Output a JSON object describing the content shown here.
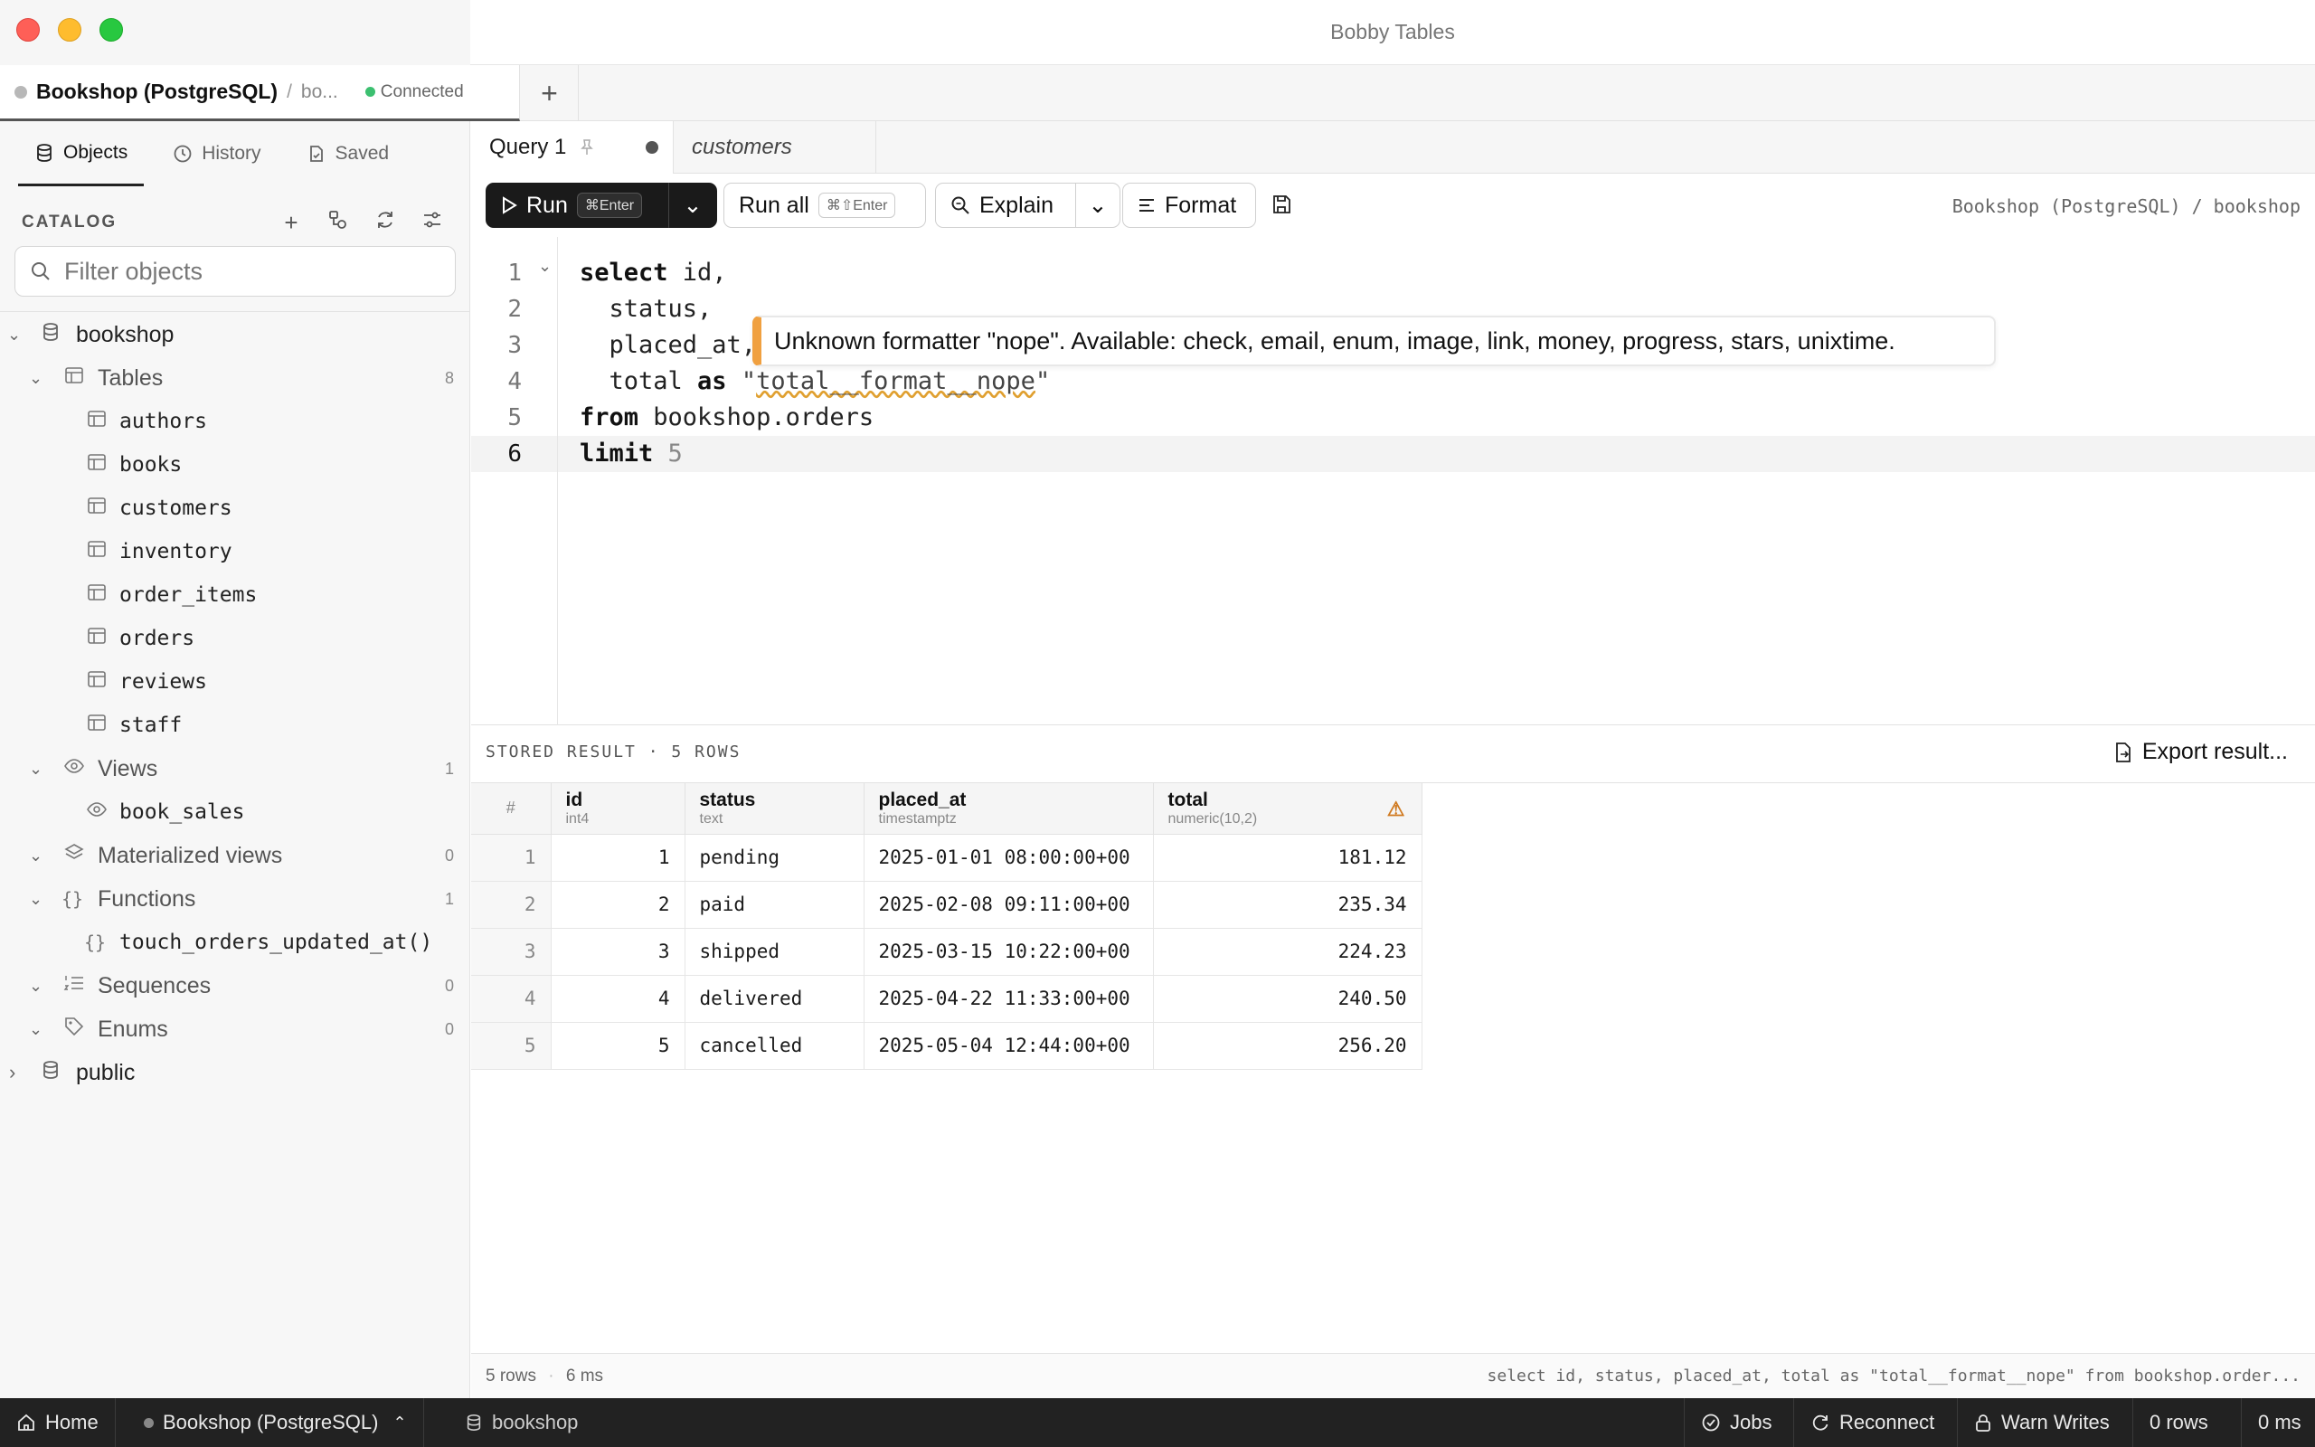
{
  "window": {
    "title": "Bobby Tables"
  },
  "connection_tab": {
    "name": "Bookshop (PostgreSQL)",
    "separator": "/",
    "database": "bo...",
    "status": "Connected",
    "status_color": "#3cc070"
  },
  "sidebar": {
    "tabs": [
      {
        "label": "Objects"
      },
      {
        "label": "History"
      },
      {
        "label": "Saved"
      }
    ],
    "catalog_label": "CATALOG",
    "filter_placeholder": "Filter objects",
    "tree": {
      "schema": "bookshop",
      "tables_label": "Tables",
      "tables_count": "8",
      "tables": [
        "authors",
        "books",
        "customers",
        "inventory",
        "order_items",
        "orders",
        "reviews",
        "staff"
      ],
      "views_label": "Views",
      "views_count": "1",
      "views": [
        "book_sales"
      ],
      "matviews_label": "Materialized views",
      "matviews_count": "0",
      "functions_label": "Functions",
      "functions_count": "1",
      "functions": [
        "touch_orders_updated_at()"
      ],
      "sequences_label": "Sequences",
      "sequences_count": "0",
      "enums_label": "Enums",
      "enums_count": "0",
      "schema2": "public"
    }
  },
  "query_tabs": [
    {
      "label": "Query 1"
    },
    {
      "label": "customers"
    }
  ],
  "toolbar": {
    "run_label": "Run",
    "run_shortcut": "⌘Enter",
    "run_all_label": "Run all",
    "run_all_shortcut": "⌘⇧Enter",
    "explain_label": "Explain",
    "format_label": "Format",
    "breadcrumb": "Bookshop (PostgreSQL) / bookshop"
  },
  "editor": {
    "line_numbers": [
      "1",
      "2",
      "3",
      "4",
      "5",
      "6"
    ],
    "lines": {
      "l1_kw": "select",
      "l1_rest": " id,",
      "l2": "  status,",
      "l3": "  placed_at,",
      "l4_a": "  total ",
      "l4_kw": "as",
      "l4_q1": " \"",
      "l4_str": "total__format__nope",
      "l4_q2": "\"",
      "l5_kw": "from",
      "l5_rest": " bookshop.orders",
      "l6_kw": "limit",
      "l6_num": "5"
    },
    "tooltip": "Unknown formatter \"nope\". Available: check, email, enum, image, link, money, progress, stars, unixtime."
  },
  "results": {
    "title": "STORED RESULT · 5 ROWS",
    "export_label": "Export result...",
    "columns": [
      {
        "name": "id",
        "type": "int4"
      },
      {
        "name": "status",
        "type": "text"
      },
      {
        "name": "placed_at",
        "type": "timestamptz"
      },
      {
        "name": "total",
        "type": "numeric(10,2)"
      }
    ],
    "rownum_header": "#",
    "rows": [
      {
        "n": "1",
        "id": "1",
        "status": "pending",
        "placed_at": "2025-01-01 08:00:00+00",
        "total": "181.12"
      },
      {
        "n": "2",
        "id": "2",
        "status": "paid",
        "placed_at": "2025-02-08 09:11:00+00",
        "total": "235.34"
      },
      {
        "n": "3",
        "id": "3",
        "status": "shipped",
        "placed_at": "2025-03-15 10:22:00+00",
        "total": "224.23"
      },
      {
        "n": "4",
        "id": "4",
        "status": "delivered",
        "placed_at": "2025-04-22 11:33:00+00",
        "total": "240.50"
      },
      {
        "n": "5",
        "id": "5",
        "status": "cancelled",
        "placed_at": "2025-05-04 12:44:00+00",
        "total": "256.20"
      }
    ]
  },
  "stats": {
    "rows": "5 rows",
    "sep": "·",
    "time": "6 ms",
    "sql": "select id, status, placed_at, total as \"total__format__nope\" from bookshop.order..."
  },
  "statusbar": {
    "home": "Home",
    "connection": "Bookshop (PostgreSQL)",
    "database": "bookshop",
    "jobs": "Jobs",
    "reconnect": "Reconnect",
    "writes": "Warn Writes",
    "rows": "0 rows",
    "time": "0 ms"
  }
}
